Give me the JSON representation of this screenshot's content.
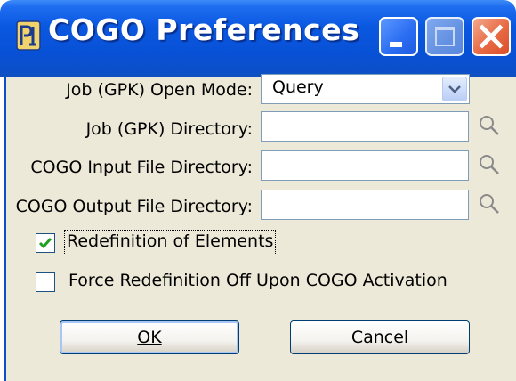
{
  "window": {
    "title": "COGO Preferences"
  },
  "form": {
    "open_mode": {
      "label": "Job (GPK) Open Mode:",
      "value": "Query"
    },
    "job_directory": {
      "label": "Job (GPK) Directory:",
      "value": ""
    },
    "input_directory": {
      "label": "COGO Input File Directory:",
      "value": ""
    },
    "output_directory": {
      "label": "COGO Output File Directory:",
      "value": ""
    },
    "redefinition": {
      "label": "Redefinition of Elements",
      "checked": true
    },
    "force_redefinition": {
      "label": "Force Redefinition Off Upon COGO Activation",
      "checked": false
    }
  },
  "buttons": {
    "ok_label": "OK",
    "cancel_label": "Cancel"
  },
  "icons": {
    "app": "microstation-app-icon",
    "minimize": "minimize-icon",
    "maximize": "maximize-icon",
    "close": "close-icon",
    "browse": "magnifier-icon",
    "dropdown": "chevron-down-icon",
    "check": "checkmark-icon"
  },
  "colors": {
    "titlebar": "#0a58e0",
    "dialog_bg": "#ece9d8",
    "close_button": "#e86a44",
    "checkmark": "#21a121"
  }
}
